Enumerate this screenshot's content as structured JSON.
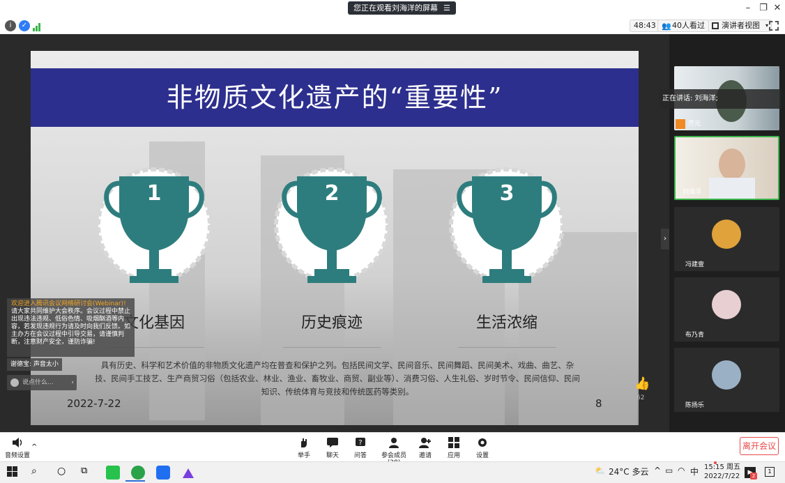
{
  "titlebar": {
    "viewing_text": "您正在观看刘海洋的屏幕",
    "menu_glyph": "☰"
  },
  "toolbar": {
    "timer": "48:43",
    "viewers": "40人看过",
    "view_mode": "演讲者视图"
  },
  "slide": {
    "title": "非物质文化遗产的“重要性”",
    "trophies": [
      {
        "number": "1",
        "label": "文化基因"
      },
      {
        "number": "2",
        "label": "历史痕迹"
      },
      {
        "number": "3",
        "label": "生活浓缩"
      }
    ],
    "description": "具有历史、科学和艺术价值的非物质文化遗产均在普查和保护之列。包括民间文学、民间音乐、民间舞蹈、民间美术、戏曲、曲艺、杂技、民间手工技艺、生产商贸习俗（包括农业、林业、渔业、畜牧业、商贸、副业等）、消费习俗、人生礼俗、岁时节令、民间信仰、民间知识、传统体育与竞技和传统医药等类别。",
    "date": "2022-7-22",
    "page": "8"
  },
  "chat": {
    "header": "欢迎进入腾讯会议网络研讨会(Webinar)!",
    "message": "请大家共同维护大会秩序。会议过程中禁止出现违法违规、低俗色情、吸烟酗酒等内容，若发现违规行为请及时向我们反馈。如主办方在会议过程中引导交易，请谨慎判断，注意财产安全，谨防诈骗!",
    "thanks": "谢德宝: 声音太小",
    "input_placeholder": "说点什么..."
  },
  "like_count": "62",
  "panel": {
    "speaking": "正在讲话: 刘海洋;",
    "participants": [
      {
        "name": "芥元"
      },
      {
        "name": "刘海洋"
      },
      {
        "name": "冯建壹"
      },
      {
        "name": "布乃青"
      },
      {
        "name": "陈扬乐"
      }
    ]
  },
  "controls": {
    "audio": "音频设置",
    "raise_hand": "举手",
    "chat": "聊天",
    "qa": "问答",
    "members": "参会成员(28)",
    "invite": "邀请",
    "apps": "应用",
    "settings": "设置",
    "leave": "离开会议"
  },
  "taskbar": {
    "weather": "24°C 多云",
    "ime": "中",
    "time": "15:15 周五",
    "date": "2022/7/22",
    "notif_count": "1",
    "badge": "2"
  },
  "colors": {
    "banner": "#2d2f8e",
    "trophy": "#2e7d7e",
    "leave": "#e84a4a",
    "active_border": "#3ab54a"
  }
}
